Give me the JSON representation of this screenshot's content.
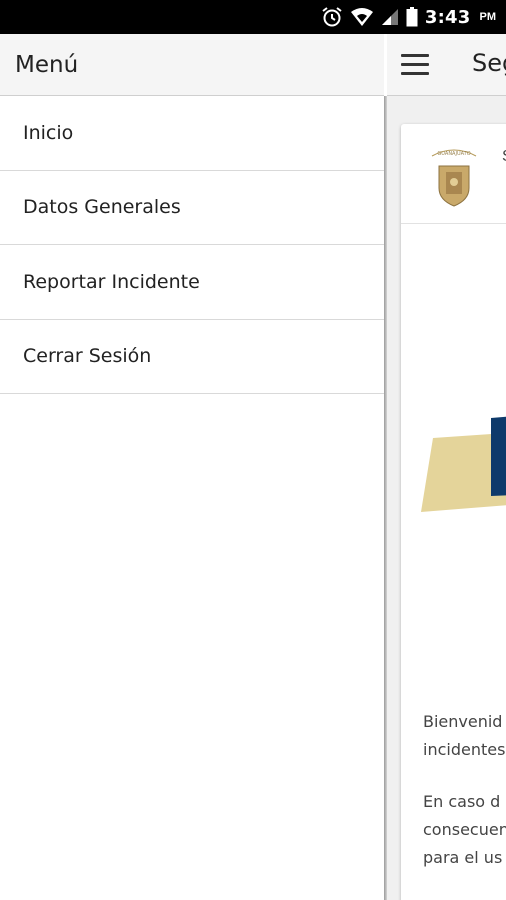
{
  "status_bar": {
    "time": "3:43",
    "ampm": "PM",
    "icons": [
      "alarm-icon",
      "wifi-icon",
      "signal-icon",
      "battery-icon"
    ]
  },
  "drawer": {
    "title": "Menú",
    "items": [
      {
        "label": "Inicio"
      },
      {
        "label": "Datos Generales"
      },
      {
        "label": "Reportar Incidente"
      },
      {
        "label": "Cerrar Sesión"
      }
    ]
  },
  "page": {
    "title_partial": "Seg",
    "card_header_partial": "S",
    "seal_text": "GUANAJUATO",
    "paragraph1": [
      "Bienvenid",
      "incidentes"
    ],
    "paragraph2": [
      "En caso d",
      "consecuen",
      "para el us"
    ]
  },
  "colors": {
    "banner_gold": "#E4D49A",
    "banner_navy": "#0E3A6B",
    "statusbar_bg": "#000000",
    "header_bg": "#F5F5F5"
  }
}
